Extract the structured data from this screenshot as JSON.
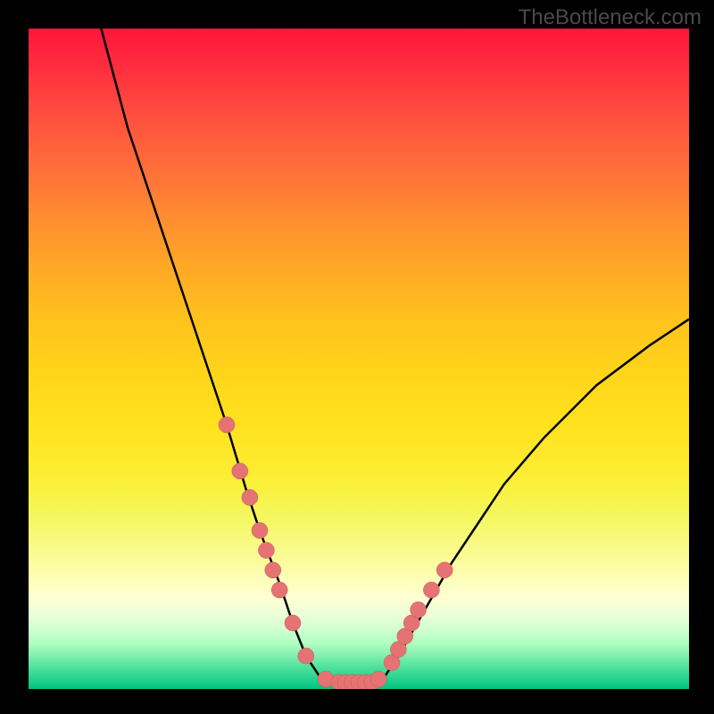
{
  "watermark": "TheBottleneck.com",
  "chart_data": {
    "type": "line",
    "title": "",
    "xlabel": "",
    "ylabel": "",
    "xlim": [
      0,
      100
    ],
    "ylim": [
      0,
      100
    ],
    "legend": false,
    "series": [
      {
        "name": "bottleneck-curve",
        "description": "Black V-shaped curve; y estimated as percentage above bottom of plot (0=bottom, 100=top)",
        "x": [
          11,
          15,
          20,
          25,
          30,
          33,
          35,
          38,
          40,
          42,
          44,
          46,
          48,
          50,
          52,
          54,
          56,
          60,
          64,
          68,
          72,
          78,
          86,
          94,
          100
        ],
        "y": [
          100,
          85,
          70,
          55,
          40,
          30,
          24,
          16,
          10,
          5,
          2,
          1,
          1,
          1,
          1,
          2,
          5,
          12,
          19,
          25,
          31,
          38,
          46,
          52,
          56
        ]
      },
      {
        "name": "marker-dots",
        "description": "Coral dots along lower portion of the curve",
        "x": [
          30,
          32,
          33.5,
          35,
          36,
          37,
          38,
          40,
          42,
          45,
          47,
          48,
          49,
          50,
          51,
          52,
          53,
          55,
          56,
          57,
          58,
          59,
          61,
          63
        ],
        "y": [
          40,
          33,
          29,
          24,
          21,
          18,
          15,
          10,
          5,
          1.5,
          1,
          1,
          1,
          1,
          1,
          1,
          1.5,
          4,
          6,
          8,
          10,
          12,
          15,
          18
        ]
      }
    ],
    "background_gradient_stops": [
      {
        "pos": 0.0,
        "color": "#fe163b"
      },
      {
        "pos": 0.5,
        "color": "#ffd41a"
      },
      {
        "pos": 0.85,
        "color": "#ffffd2"
      },
      {
        "pos": 1.0,
        "color": "#00c47f"
      }
    ]
  }
}
